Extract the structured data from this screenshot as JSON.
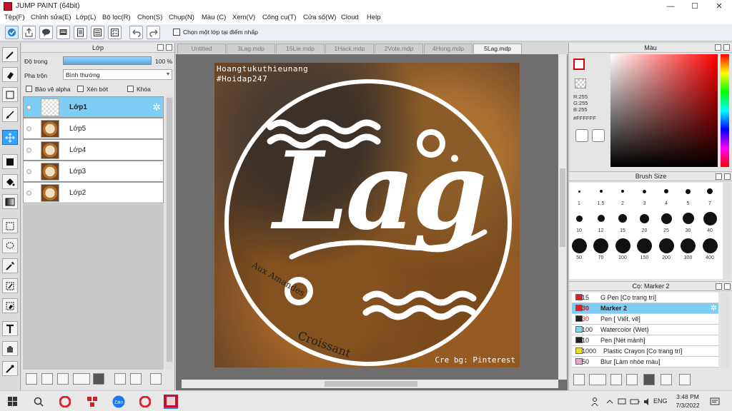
{
  "window": {
    "title": "JUMP PAINT (64bit)",
    "minimize": "—",
    "maximize": "☐",
    "close": "✕"
  },
  "menu": [
    "Tệp(F)",
    "Chỉnh sửa(E)",
    "Lớp(L)",
    "Bộ lọc(R)",
    "Chọn(S)",
    "Chụp(N)",
    "Màu (C)",
    "Xem(V)",
    "Công cụ(T)",
    "Cửa sổ(W)",
    "Cloud",
    "Help"
  ],
  "toolbar": {
    "reference_label": "Chọn một lớp tại điểm nhấp"
  },
  "layers": {
    "title": "Lớp",
    "opacity_label": "Độ trong",
    "opacity_value": "100 %",
    "opacity": 1.0,
    "blend_label": "Pha trộn",
    "blend_value": "Bình thường",
    "protect_alpha": "Bảo vệ alpha",
    "clipping": "Xén bớt",
    "lock": "Khóa",
    "items": [
      {
        "name": "Lớp1",
        "selected": true
      },
      {
        "name": "Lớp5"
      },
      {
        "name": "Lớp4"
      },
      {
        "name": "Lớp3"
      },
      {
        "name": "Lớp2"
      }
    ]
  },
  "tabs": [
    "Untitled",
    "3Lag.mdp",
    "15Lie.mdp",
    "1Hack.mdp",
    "2Vote.mdp",
    "4Hong.mdp",
    "5Lag.mdp"
  ],
  "artwork": {
    "watermark_line1": "Hoangtukuthieunang",
    "watermark_line2": "#Hoidap247",
    "main_text": "Lag",
    "credit": "Cre bg: Pinterest",
    "box_text1": "Croissant",
    "box_text2": "Aux Amandes"
  },
  "color": {
    "title": "Màu",
    "r": "R:255",
    "g": "G:255",
    "b": "B:255",
    "hex": "#FFFFFF",
    "primary": "#ffffff",
    "accent": "#e00000"
  },
  "brush_size": {
    "title": "Brush Size",
    "sizes": [
      "1",
      "1.5",
      "2",
      "3",
      "4",
      "5",
      "7",
      "10",
      "12",
      "15",
      "20",
      "25",
      "30",
      "40",
      "50",
      "70",
      "100",
      "150",
      "200",
      "300",
      "400"
    ]
  },
  "brushes": {
    "title": "Cọ: Marker 2",
    "items": [
      {
        "value": "15",
        "name": "G Pen [Cọ trang trí]",
        "color": "#e02020"
      },
      {
        "value": "30",
        "name": "Marker 2",
        "color": "#e02020",
        "selected": true
      },
      {
        "value": "30",
        "name": "Pen [ Viết, vẽ]",
        "color": "#202020"
      },
      {
        "value": "100",
        "name": "Watercolor (Wet)",
        "color": "#7fd6f2"
      },
      {
        "value": "10",
        "name": "Pen [Nét mảnh]",
        "color": "#202020"
      },
      {
        "value": "1000",
        "name": "Plastic Crayon [Cọ trang trí]",
        "color": "#f2e020"
      },
      {
        "value": "50",
        "name": "Blur [Làm nhòe màu]",
        "color": "#f2a0d0"
      }
    ]
  },
  "taskbar": {
    "time": "3:48 PM",
    "date": "7/3/2022",
    "lang": "ENG"
  }
}
